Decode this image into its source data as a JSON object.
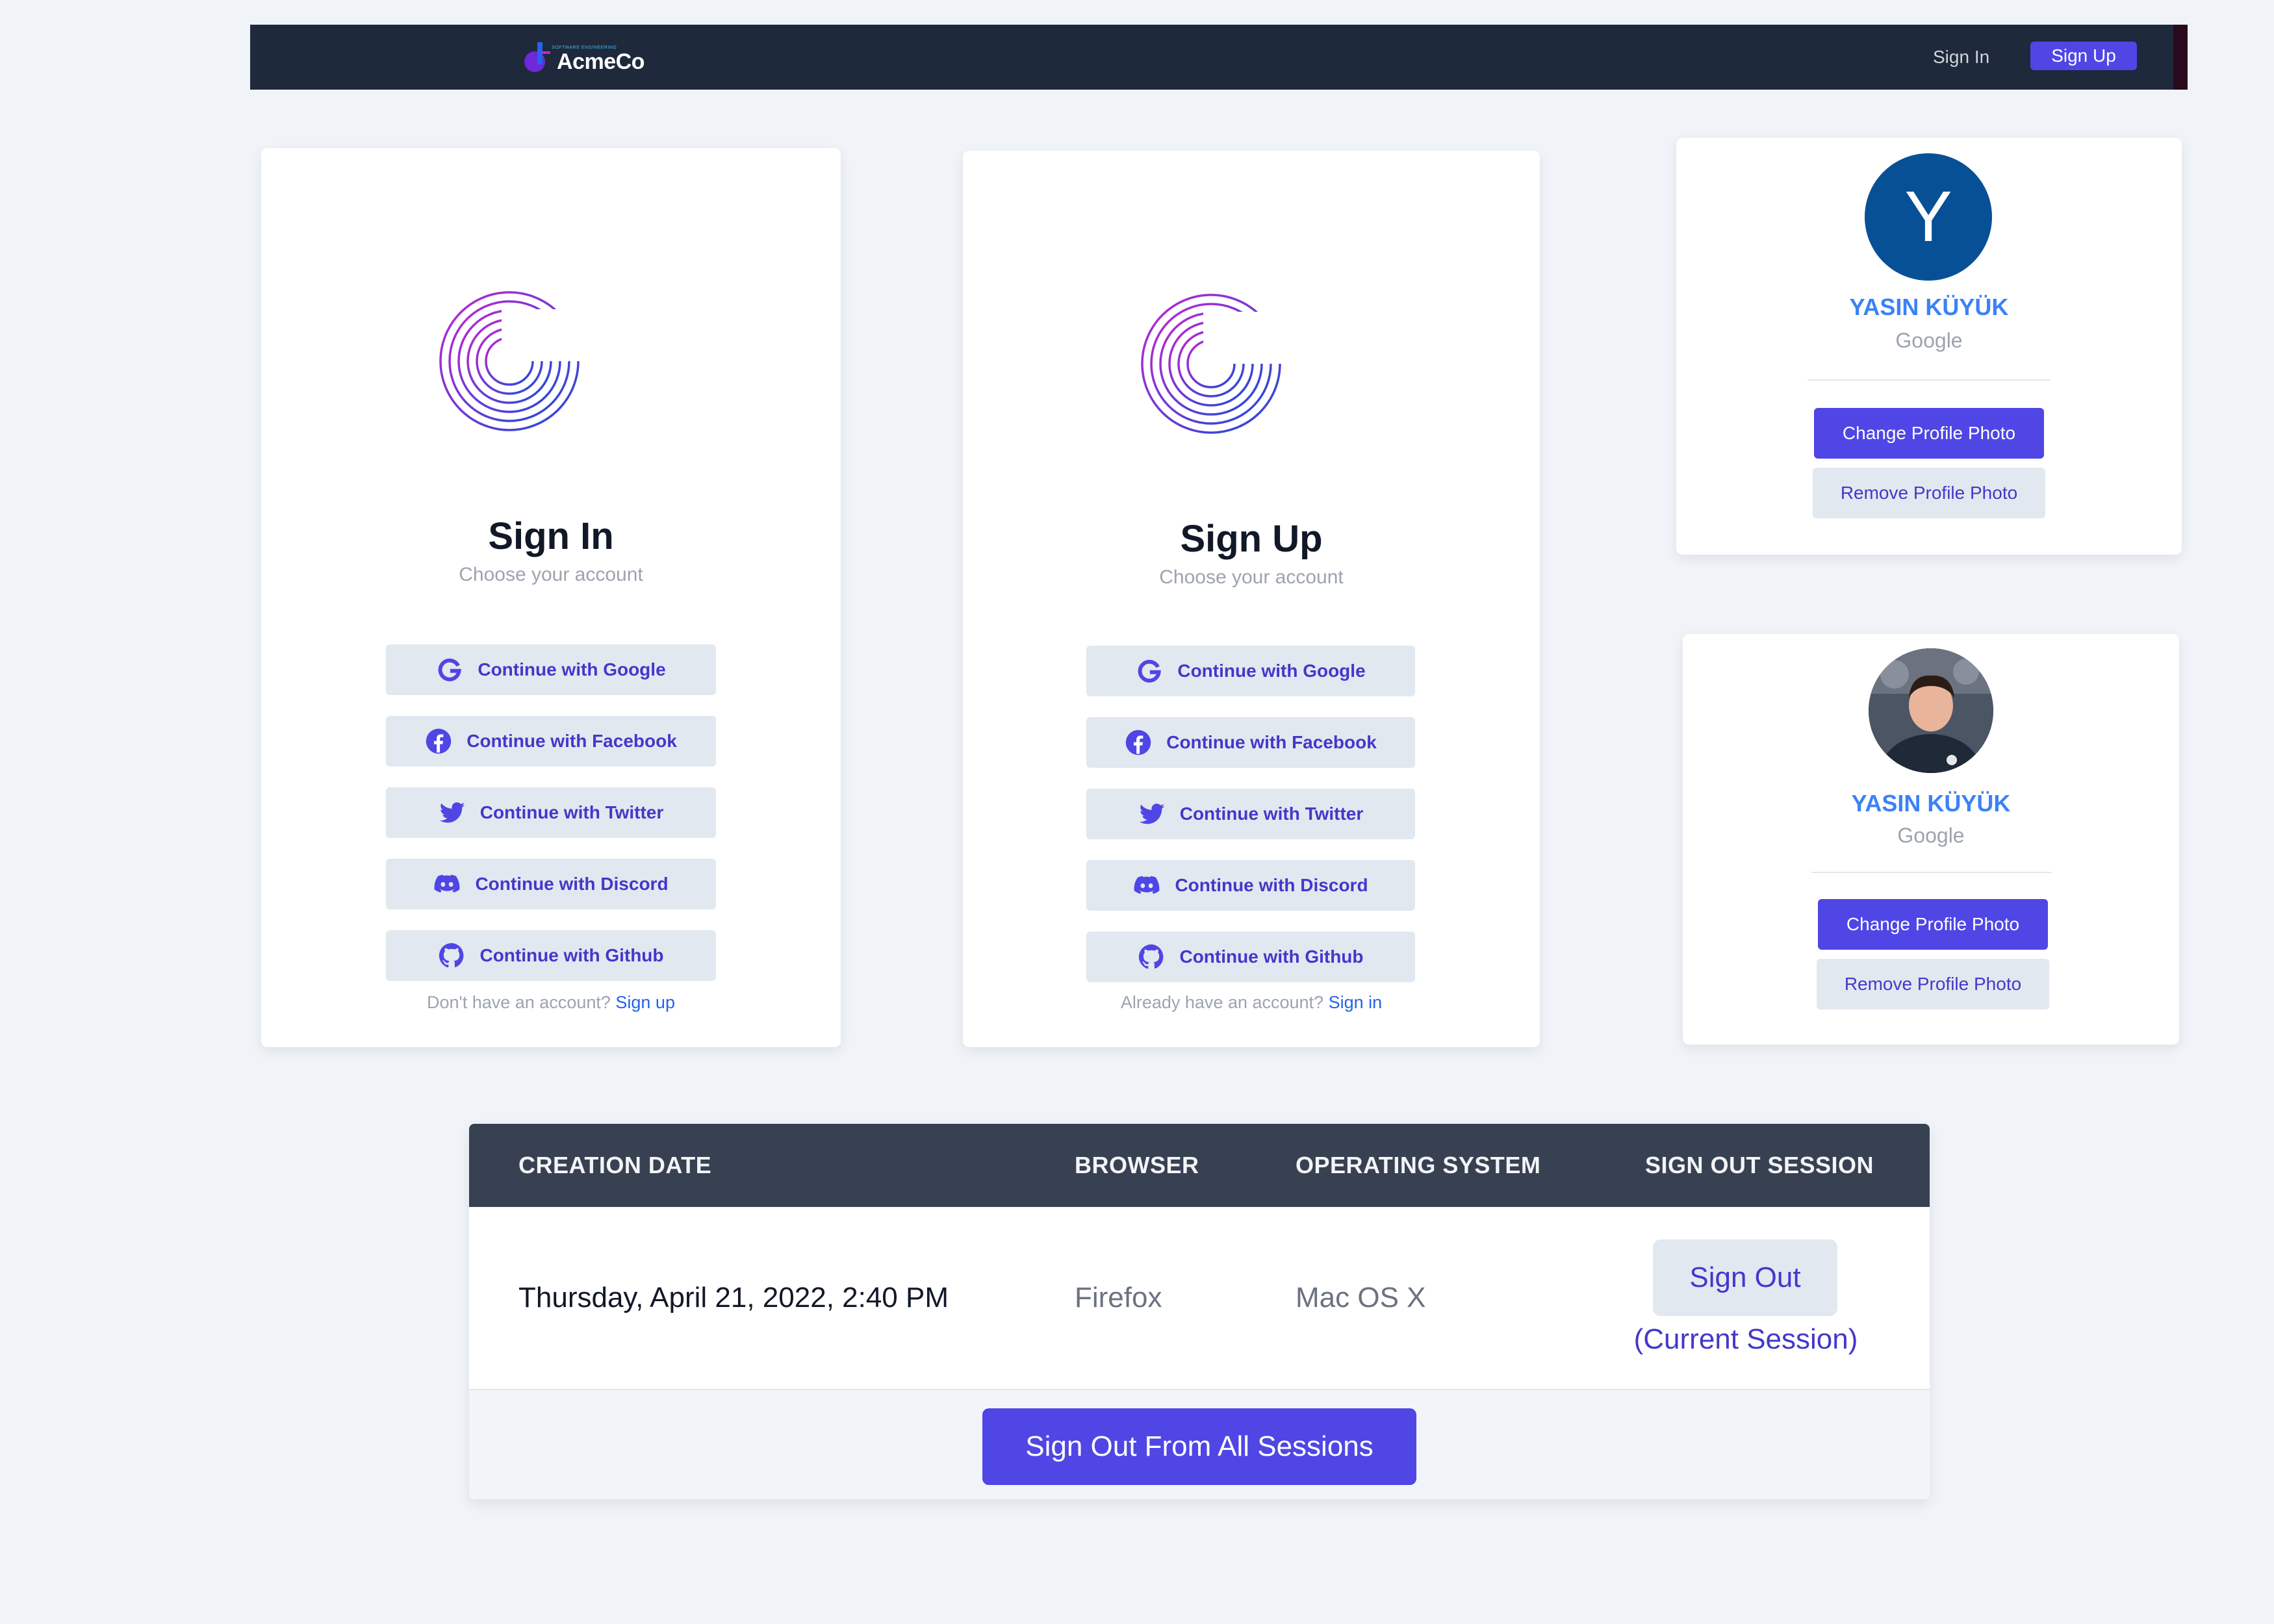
{
  "navbar": {
    "brand_name": "AcmeCo",
    "brand_tagline": "SOFTWARE ENGINEERING",
    "signin_label": "Sign In",
    "signup_label": "Sign Up"
  },
  "signin_card": {
    "title": "Sign In",
    "subtitle": "Choose your account",
    "providers": [
      {
        "label": "Continue with Google",
        "icon": "google-icon"
      },
      {
        "label": "Continue with Facebook",
        "icon": "facebook-icon"
      },
      {
        "label": "Continue with Twitter",
        "icon": "twitter-icon"
      },
      {
        "label": "Continue with Discord",
        "icon": "discord-icon"
      },
      {
        "label": "Continue with Github",
        "icon": "github-icon"
      }
    ],
    "footer_text": "Don't have an account?",
    "footer_link": "Sign up"
  },
  "signup_card": {
    "title": "Sign Up",
    "subtitle": "Choose your account",
    "providers": [
      {
        "label": "Continue with Google",
        "icon": "google-icon"
      },
      {
        "label": "Continue with Facebook",
        "icon": "facebook-icon"
      },
      {
        "label": "Continue with Twitter",
        "icon": "twitter-icon"
      },
      {
        "label": "Continue with Discord",
        "icon": "discord-icon"
      },
      {
        "label": "Continue with Github",
        "icon": "github-icon"
      }
    ],
    "footer_text": "Already have an account?",
    "footer_link": "Sign in"
  },
  "profile_cards": [
    {
      "avatar_initial": "Y",
      "name": "YASIN KÜYÜK",
      "provider": "Google",
      "change_photo": "Change Profile Photo",
      "remove_photo": "Remove Profile Photo"
    },
    {
      "avatar": "user-photo",
      "name": "YASIN KÜYÜK",
      "provider": "Google",
      "change_photo": "Change Profile Photo",
      "remove_photo": "Remove Profile Photo"
    }
  ],
  "sessions": {
    "columns": [
      "CREATION DATE",
      "BROWSER",
      "OPERATING SYSTEM",
      "SIGN OUT SESSION"
    ],
    "rows": [
      {
        "creation_date": "Thursday, April 21, 2022, 2:40 PM",
        "browser": "Firefox",
        "os": "Mac OS X",
        "action": "Sign Out",
        "note": "(Current Session)"
      }
    ],
    "sign_out_all": "Sign Out From All Sessions"
  },
  "colors": {
    "accent": "#4f46e5",
    "navbar": "#1e293b",
    "table_header": "#374151",
    "link": "#2563eb",
    "name": "#3b82f6"
  }
}
